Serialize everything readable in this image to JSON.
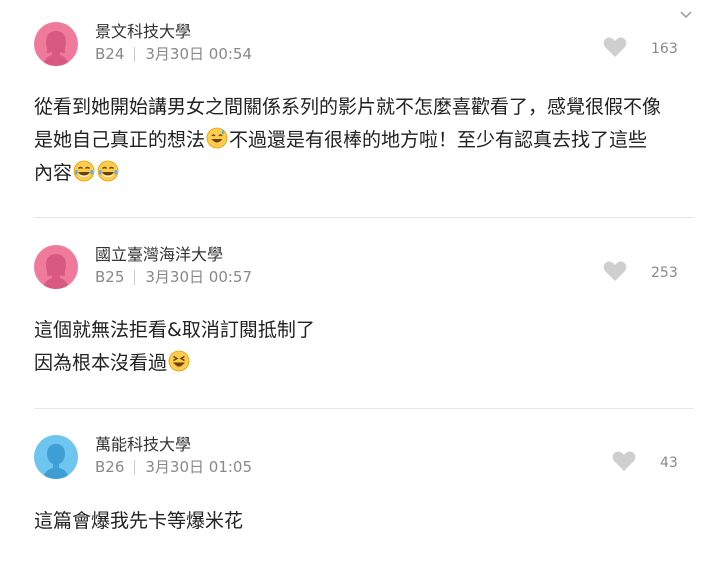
{
  "comments": [
    {
      "school": "景文科技大學",
      "floor": "B24",
      "time": "3月30日 00:54",
      "likes": "163",
      "avatar": "female",
      "lines": [
        [
          "從看到她開始講男女之間關係系列的影片就不怎麼喜歡看了，感覺很假不像"
        ],
        [
          "是她自己真正的想法",
          "不過還是有很棒的地方啦！至少有認真去找了這些"
        ],
        [
          "內容"
        ]
      ]
    },
    {
      "school": "國立臺灣海洋大學",
      "floor": "B25",
      "time": "3月30日 00:57",
      "likes": "253",
      "avatar": "female",
      "lines": [
        [
          "這個就無法拒看&取消訂閱抵制了"
        ],
        [
          "因為根本沒看過"
        ]
      ]
    },
    {
      "school": "萬能科技大學",
      "floor": "B26",
      "time": "3月30日 01:05",
      "likes": "43",
      "avatar": "male",
      "lines": [
        [
          "這篇會爆我先卡等爆米花"
        ]
      ]
    }
  ],
  "colors": {
    "female_avatar": "#f07a9b",
    "male_avatar": "#6ec6f0",
    "heart": "#cfcfcf"
  },
  "icons": {
    "collapse": "chevron-down-icon",
    "like": "heart-icon",
    "emoji_sweat": "sweat-smile-emoji",
    "emoji_joy": "tears-of-joy-emoji",
    "emoji_laugh": "squint-laugh-emoji"
  }
}
